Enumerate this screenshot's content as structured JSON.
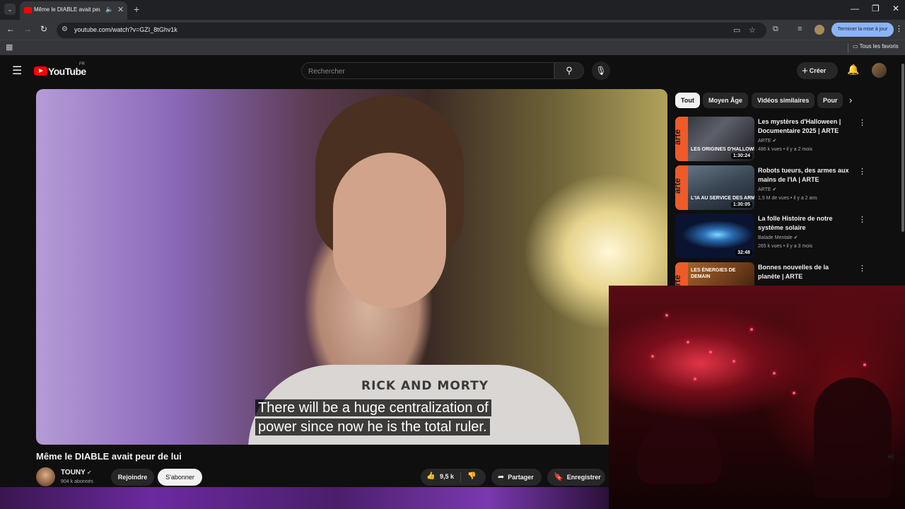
{
  "browser": {
    "tab_title": "Même le DIABLE avait peur de lui",
    "url": "youtube.com/watch?v=GZI_8tGhv1k",
    "update_button": "Terminer la mise à jour",
    "bookmarks_folder": "Tous les favoris"
  },
  "header": {
    "logo_text": "YouTube",
    "country_code": "FR",
    "search_placeholder": "Rechercher",
    "create_label": "Créer"
  },
  "video": {
    "title": "Même le DIABLE avait peur de lui",
    "caption_line1": "There will be a huge centralization of",
    "caption_line2": "power since now he is the total ruler.",
    "shirt_text": "RICK AND MORTY"
  },
  "channel": {
    "name": "TOUNY",
    "subscribers": "904 k abonnés",
    "join_label": "Rejoindre",
    "subscribe_label": "S'abonner"
  },
  "actions": {
    "like_count": "9,5 k",
    "share_label": "Partager",
    "save_label": "Enregistrer"
  },
  "chips": [
    "Tout",
    "Moyen Âge",
    "Vidéos similaires",
    "Pour"
  ],
  "recommendations": [
    {
      "title": "Les mystères d'Halloween | Documentaire 2025 | ARTE",
      "channel": "ARTE",
      "views": "486 k vues",
      "age": "il y a 2 mois",
      "duration": "1:30:24",
      "thumb_text": "LES ORIGINES D'HALLOWE"
    },
    {
      "title": "Robots tueurs, des armes aux mains de l'IA | ARTE",
      "channel": "ARTE",
      "views": "1,5 M de vues",
      "age": "il y a 2 ans",
      "duration": "1:30:05",
      "thumb_text": "L'IA AU SERVICE DES ARMES"
    },
    {
      "title": "La folle Histoire de notre système solaire",
      "channel": "Balade Mentale",
      "views": "265 k vues",
      "age": "il y a 3 mois",
      "duration": "32:48",
      "thumb_text": ""
    },
    {
      "title": "Bonnes nouvelles de la planète | ARTE",
      "channel": "ARTE",
      "views": "",
      "age": "",
      "duration": "",
      "thumb_text": "LES ÉNERGIES DE DEMAIN"
    }
  ],
  "colors": {
    "yt_red": "#ff0000",
    "arte_orange": "#ef5a29",
    "update_blue": "#8ab4f8"
  }
}
